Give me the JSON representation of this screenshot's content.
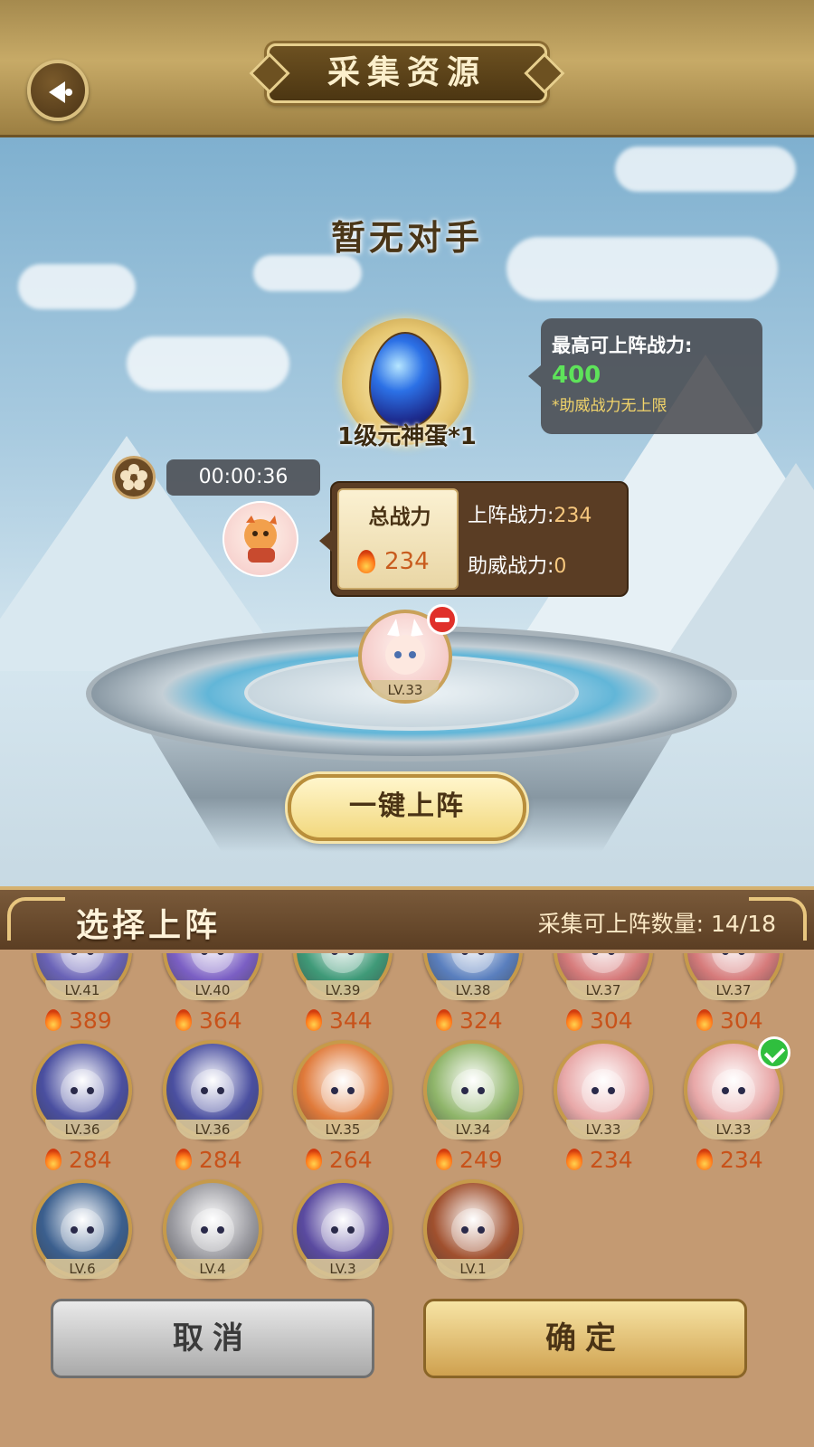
{
  "header": {
    "title": "采集资源"
  },
  "scene": {
    "opponent_text": "暂无对手",
    "reward_label": "1级元神蛋*1",
    "tooltip": {
      "label": "最高可上阵战力:",
      "value": "400",
      "note": "*助威战力无上限"
    },
    "timer": "00:00:36",
    "power": {
      "total_label": "总战力",
      "total_value": "234",
      "deploy_label": "上阵战力:",
      "deploy_value": "234",
      "cheer_label": "助威战力:",
      "cheer_value": "0"
    },
    "slot": {
      "level": "LV.33"
    },
    "auto_deploy_label": "一键上阵"
  },
  "panel": {
    "title": "选择上阵",
    "count_label": "采集可上阵数量:",
    "count_value": "14/18",
    "heroes_row1": [
      {
        "level": "LV.41",
        "power": "389",
        "color": "#6a63b7"
      },
      {
        "level": "LV.40",
        "power": "364",
        "color": "#7b5fc4"
      },
      {
        "level": "LV.39",
        "power": "344",
        "color": "#3f9a78"
      },
      {
        "level": "LV.38",
        "power": "324",
        "color": "#5a7fbe"
      },
      {
        "level": "LV.37",
        "power": "304",
        "color": "#d67b7b"
      },
      {
        "level": "LV.37",
        "power": "304",
        "color": "#d67b7b"
      }
    ],
    "heroes_row2": [
      {
        "level": "LV.36",
        "power": "284",
        "color": "#4a4fa0"
      },
      {
        "level": "LV.36",
        "power": "284",
        "color": "#4a4fa0"
      },
      {
        "level": "LV.35",
        "power": "264",
        "color": "#e07a3a"
      },
      {
        "level": "LV.34",
        "power": "249",
        "color": "#8fb56a"
      },
      {
        "level": "LV.33",
        "power": "234",
        "color": "#e8a8a8"
      },
      {
        "level": "LV.33",
        "power": "234",
        "color": "#e8a8a8",
        "selected": true
      }
    ],
    "heroes_row3": [
      {
        "level": "LV.6",
        "color": "#3b5f8e"
      },
      {
        "level": "LV.4",
        "color": "#9a9aa0"
      },
      {
        "level": "LV.3",
        "color": "#5a4aa0"
      },
      {
        "level": "LV.1",
        "color": "#a0502e"
      }
    ],
    "cancel_label": "取消",
    "confirm_label": "确定"
  }
}
